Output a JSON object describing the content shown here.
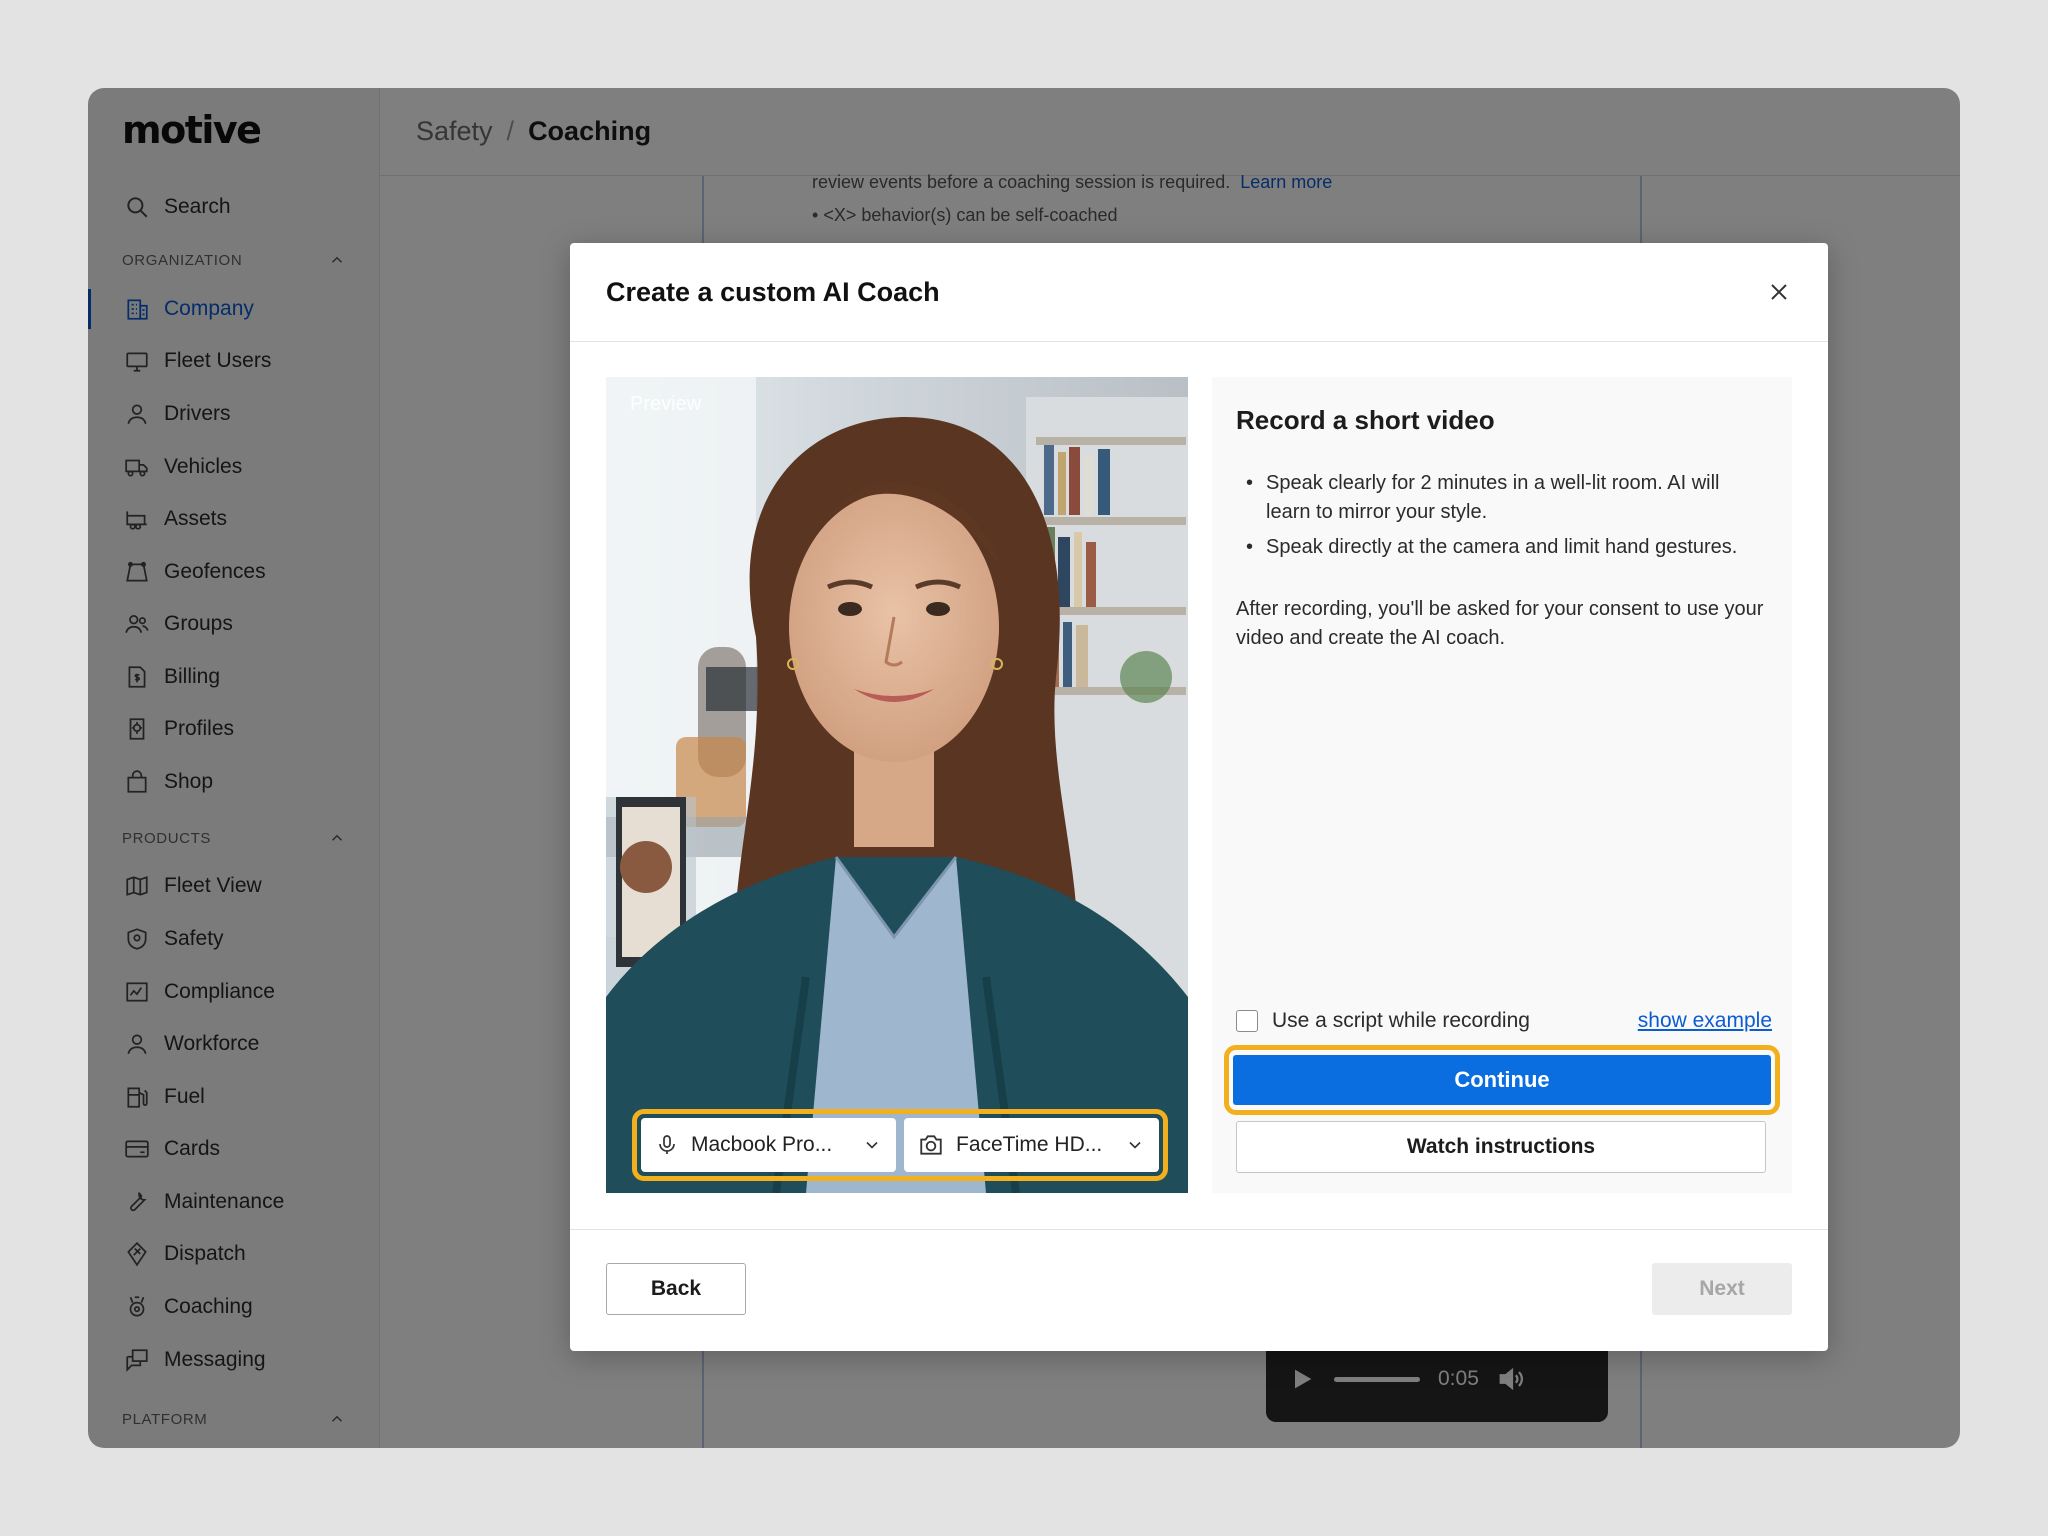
{
  "app": {
    "logo": "motive",
    "breadcrumb": {
      "parent": "Safety",
      "separator": "/",
      "current": "Coaching"
    }
  },
  "sidebar": {
    "search_label": "Search",
    "sections": {
      "organization": "ORGANIZATION",
      "products": "PRODUCTS",
      "platform": "PLATFORM"
    },
    "org_items": [
      {
        "label": "Company",
        "icon": "building-icon",
        "active": true
      },
      {
        "label": "Fleet Users",
        "icon": "monitor-icon"
      },
      {
        "label": "Drivers",
        "icon": "person-icon"
      },
      {
        "label": "Vehicles",
        "icon": "truck-icon"
      },
      {
        "label": "Assets",
        "icon": "trailer-icon"
      },
      {
        "label": "Geofences",
        "icon": "geofence-icon"
      },
      {
        "label": "Groups",
        "icon": "groups-icon"
      },
      {
        "label": "Billing",
        "icon": "billing-icon"
      },
      {
        "label": "Profiles",
        "icon": "profiles-icon"
      },
      {
        "label": "Shop",
        "icon": "shopping-bag-icon"
      }
    ],
    "product_items": [
      {
        "label": "Fleet View",
        "icon": "map-icon"
      },
      {
        "label": "Safety",
        "icon": "shield-icon"
      },
      {
        "label": "Compliance",
        "icon": "compliance-icon"
      },
      {
        "label": "Workforce",
        "icon": "person-icon"
      },
      {
        "label": "Fuel",
        "icon": "fuel-icon"
      },
      {
        "label": "Cards",
        "icon": "card-icon"
      },
      {
        "label": "Maintenance",
        "icon": "wrench-icon"
      },
      {
        "label": "Dispatch",
        "icon": "dispatch-icon"
      },
      {
        "label": "Coaching",
        "icon": "coaching-icon"
      },
      {
        "label": "Messaging",
        "icon": "messaging-icon"
      }
    ]
  },
  "background": {
    "text_line": "review events before a coaching session is required.",
    "learn_more": "Learn more",
    "bullet": "<X> behavior(s) can be self-coached",
    "player_time": "0:05"
  },
  "modal": {
    "title": "Create a custom AI Coach",
    "preview_label": "Preview",
    "mic_device": "Macbook Pro...",
    "camera_device": "FaceTime HD...",
    "info": {
      "title": "Record a short video",
      "bullets": [
        "Speak clearly for 2 minutes in a well-lit room. AI will learn to mirror your style.",
        "Speak directly at the camera and limit hand gestures."
      ],
      "paragraph": "After recording, you'll be asked for your consent to use your video and create the AI coach."
    },
    "script_checkbox_label": "Use a script while recording",
    "show_example": "show example",
    "continue_label": "Continue",
    "watch_label": "Watch instructions",
    "back_label": "Back",
    "next_label": "Next"
  },
  "colors": {
    "accent": "#0b6ee0",
    "highlight": "#f2b01e",
    "active_nav": "#0b5bd3"
  }
}
